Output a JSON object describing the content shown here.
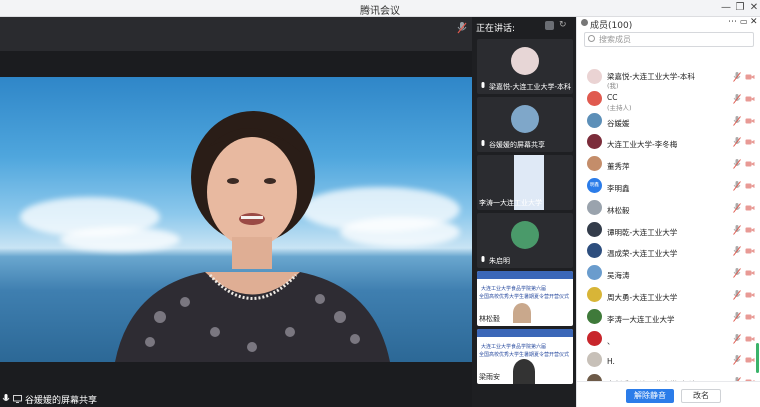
{
  "window": {
    "title": "腾讯会议"
  },
  "stage": {
    "speaker_label": "谷媛媛的屏幕共享"
  },
  "thumbnails": {
    "header": "正在讲话:",
    "items": [
      {
        "label": "梁嘉悦-大连工业大学-本科",
        "kind": "avatar",
        "color": "#e7d6d6"
      },
      {
        "label": "谷媛媛的屏幕共享",
        "kind": "avatar",
        "color": "#7fa7c9"
      },
      {
        "label": "李涛一大连工业大学",
        "kind": "slide",
        "color": "#dfe9f6"
      },
      {
        "label": "朱启明",
        "kind": "avatar",
        "color": "#4a9a6a"
      },
      {
        "label": "林松毅",
        "kind": "slide",
        "color": "#ffffff"
      },
      {
        "label": "梁雨安",
        "kind": "slide",
        "color": "#ffffff"
      }
    ],
    "slide_text": [
      "大连工业大学食品学院第六届",
      "全国高校优秀大学生暑期夏令营开营仪式"
    ]
  },
  "members": {
    "header": "成员(100)",
    "search_placeholder": "搜索成员",
    "list": [
      {
        "name": "梁嘉悦-大连工业大学-本科",
        "sub": "(我)",
        "color": "#ead3d3"
      },
      {
        "name": "CC",
        "sub": "(主持人)",
        "color": "#e05a4f"
      },
      {
        "name": "谷媛媛",
        "sub": "",
        "color": "#5c8fb8"
      },
      {
        "name": "大连工业大学-李冬梅",
        "sub": "",
        "color": "#7b2c3a"
      },
      {
        "name": "董秀萍",
        "sub": "",
        "color": "#c48d6a"
      },
      {
        "name": "李明鑫",
        "sub": "",
        "color": "#2b7ce9",
        "initials": "明鑫"
      },
      {
        "name": "林松毅",
        "sub": "",
        "color": "#9aa3ad"
      },
      {
        "name": "谭明乾-大连工业大学",
        "sub": "",
        "color": "#333c4a"
      },
      {
        "name": "温成荣-大连工业大学",
        "sub": "",
        "color": "#2d4e7e"
      },
      {
        "name": "吴海涛",
        "sub": "",
        "color": "#6a9ccd"
      },
      {
        "name": "周大勇-大连工业大学",
        "sub": "",
        "color": "#d8b537"
      },
      {
        "name": "李涛一大连工业大学",
        "sub": "",
        "color": "#3f7a3a"
      },
      {
        "name": "、",
        "sub": "",
        "color": "#c8262c"
      },
      {
        "name": "H.",
        "sub": "",
        "color": "#c7c0b8"
      },
      {
        "name": "白剑兵-大连工业大学-本科",
        "sub": "",
        "color": "#6d5a48"
      }
    ],
    "unmute_all": "解除静音",
    "rename": "改名"
  }
}
